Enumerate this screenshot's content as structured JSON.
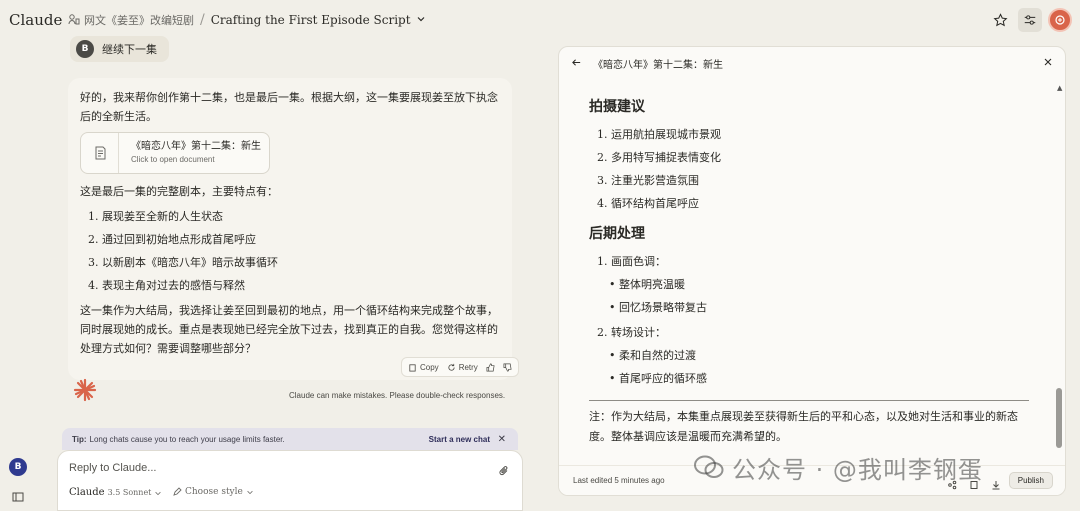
{
  "app": {
    "brand": "Claude",
    "project": "网文《姜至》改编短剧",
    "conversation_title": "Crafting the First Episode Script"
  },
  "user_message": {
    "avatar": "B",
    "text": "继续下一集"
  },
  "assistant_message": {
    "intro": "好的，我来帮你创作第十二集，也是最后一集。根据大纲，这一集要展现姜至放下执念后的全新生活。",
    "document": {
      "title": "《暗恋八年》第十二集：新生",
      "subtitle": "Click to open document"
    },
    "features_intro": "这是最后一集的完整剧本，主要特点有：",
    "features": [
      "1. 展现姜至全新的人生状态",
      "2. 通过回到初始地点形成首尾呼应",
      "3. 以新剧本《暗恋八年》暗示故事循环",
      "4. 表现主角对过去的感悟与释然"
    ],
    "closing": "这一集作为大结局，我选择让姜至回到最初的地点，用一个循环结构来完成整个故事，同时展现她的成长。重点是表现她已经完全放下过去，找到真正的自我。您觉得这样的处理方式如何？需要调整哪些部分？",
    "actions": {
      "copy": "Copy",
      "retry": "Retry"
    }
  },
  "disclaimer": "Claude can make mistakes. Please double-check responses.",
  "tip": {
    "label": "Tip:",
    "text": "Long chats cause you to reach your usage limits faster.",
    "link": "Start a new chat"
  },
  "composer": {
    "placeholder": "Reply to Claude...",
    "model": "Claude",
    "model_version": "3.5 Sonnet",
    "style": "Choose style"
  },
  "sidebar": {
    "avatar": "B"
  },
  "artifact": {
    "title": "《暗恋八年》第十二集：新生",
    "section1_title": "拍摄建议",
    "section1_items": [
      "1. 运用航拍展现城市景观",
      "2. 多用特写捕捉表情变化",
      "3. 注重光影营造氛围",
      "4. 循环结构首尾呼应"
    ],
    "section2_title": "后期处理",
    "sub1_title": "1. 画面色调：",
    "sub1_items": [
      "整体明亮温暖",
      "回忆场景略带复古"
    ],
    "sub2_title": "2. 转场设计：",
    "sub2_items": [
      "柔和自然的过渡",
      "首尾呼应的循环感"
    ],
    "note": "注：作为大结局，本集重点展现姜至获得新生后的平和心态，以及她对生活和事业的新态度。整体基调应该是温暖而充满希望的。",
    "last_edited": "Last edited 5 minutes ago",
    "publish": "Publish"
  },
  "watermark": {
    "text": "公众号 · @我叫李钢蛋"
  },
  "colors": {
    "background": "#f1efe8",
    "accent": "#d9644a",
    "tip_bg": "#e3e1ea"
  }
}
